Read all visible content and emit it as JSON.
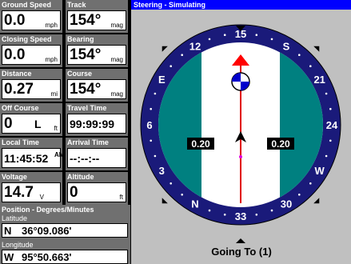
{
  "fields": [
    {
      "label": "Ground Speed",
      "value": "0.0",
      "unit": "mph"
    },
    {
      "label": "Track",
      "value": "154°",
      "unit": "mag"
    },
    {
      "label": "Closing Speed",
      "value": "0.0",
      "unit": "mph"
    },
    {
      "label": "Bearing",
      "value": "154°",
      "unit": "mag"
    },
    {
      "label": "Distance",
      "value": "0.27",
      "unit": "mi"
    },
    {
      "label": "Course",
      "value": "154°",
      "unit": "mag"
    },
    {
      "label": "Off Course",
      "value": "0",
      "value_side": "L",
      "unit": "ft"
    },
    {
      "label": "Travel Time",
      "value": "99:99:99",
      "unit": ""
    },
    {
      "label": "Local Time",
      "value": "11:45:52",
      "ampm": "AM",
      "unit": ""
    },
    {
      "label": "Arrival Time",
      "value": "--:--:--",
      "unit": ""
    },
    {
      "label": "Voltage",
      "value": "14.7",
      "unit": "V"
    },
    {
      "label": "Altitude",
      "value": "0",
      "unit": "ft"
    }
  ],
  "position": {
    "title": "Position - Degrees/Minutes",
    "latitude_label": "Latitude",
    "latitude_dir": "N",
    "latitude_value": "36°09.086'",
    "longitude_label": "Longitude",
    "longitude_dir": "W",
    "longitude_value": "95°50.663'"
  },
  "steering": {
    "title": "Steering - Simulating",
    "heading_deg": 154,
    "compass_labels": [
      "15",
      "S",
      "21",
      "24",
      "W",
      "30",
      "33",
      "N",
      "3",
      "6",
      "E",
      "12"
    ],
    "left_xte": "0.20",
    "right_xte": "0.20",
    "going_to": "Going To (1)"
  },
  "colors": {
    "ring": "#1a1a7a",
    "lane": "#008080",
    "course_line": "#ff0000",
    "panel_bg": "#c0c0c0",
    "title_bar": "#0000ff"
  }
}
